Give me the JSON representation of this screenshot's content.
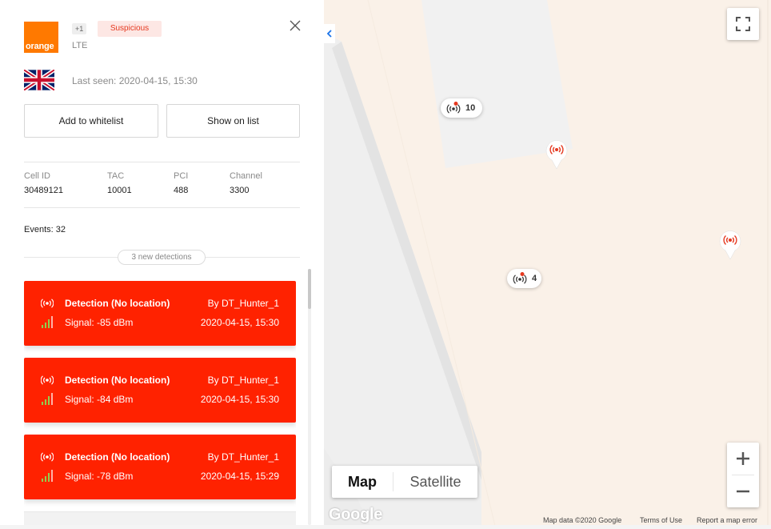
{
  "operator": {
    "logo_text": "orange",
    "extra_count": "+1",
    "status": "Suspicious",
    "technology": "LTE",
    "country_flag": "uk-flag-icon",
    "last_seen": "Last seen: 2020-04-15, 15:30"
  },
  "actions": {
    "whitelist_label": "Add to whitelist",
    "show_list_label": "Show on list"
  },
  "cell_info": [
    {
      "label": "Cell ID",
      "value": "30489121"
    },
    {
      "label": "TAC",
      "value": "10001"
    },
    {
      "label": "PCI",
      "value": "488"
    },
    {
      "label": "Channel",
      "value": "3300"
    }
  ],
  "events_label": "Events: 32",
  "new_detections_label": "3 new detections",
  "detections": [
    {
      "title": "Detection (No location)",
      "by": "By DT_Hunter_1",
      "signal": "Signal: -85 dBm",
      "time": "2020-04-15, 15:30"
    },
    {
      "title": "Detection (No location)",
      "by": "By DT_Hunter_1",
      "signal": "Signal: -84 dBm",
      "time": "2020-04-15, 15:30"
    },
    {
      "title": "Detection (No location)",
      "by": "By DT_Hunter_1",
      "signal": "Signal: -78 dBm",
      "time": "2020-04-15, 15:29"
    }
  ],
  "map": {
    "type_map_label": "Map",
    "type_satellite_label": "Satellite",
    "google_label": "Google",
    "attribution": {
      "data": "Map data ©2020 Google",
      "terms": "Terms of Use",
      "report": "Report a map error"
    },
    "clusters": [
      {
        "count": "10"
      },
      {
        "count": "4"
      }
    ]
  },
  "colors": {
    "accent_red": "#ff2200",
    "orange_brand": "#ff7900",
    "suspicious_text": "#e53920",
    "suspicious_bg": "#fde7e4",
    "map_land": "#faf1e8",
    "map_building": "#f1f1f1"
  }
}
